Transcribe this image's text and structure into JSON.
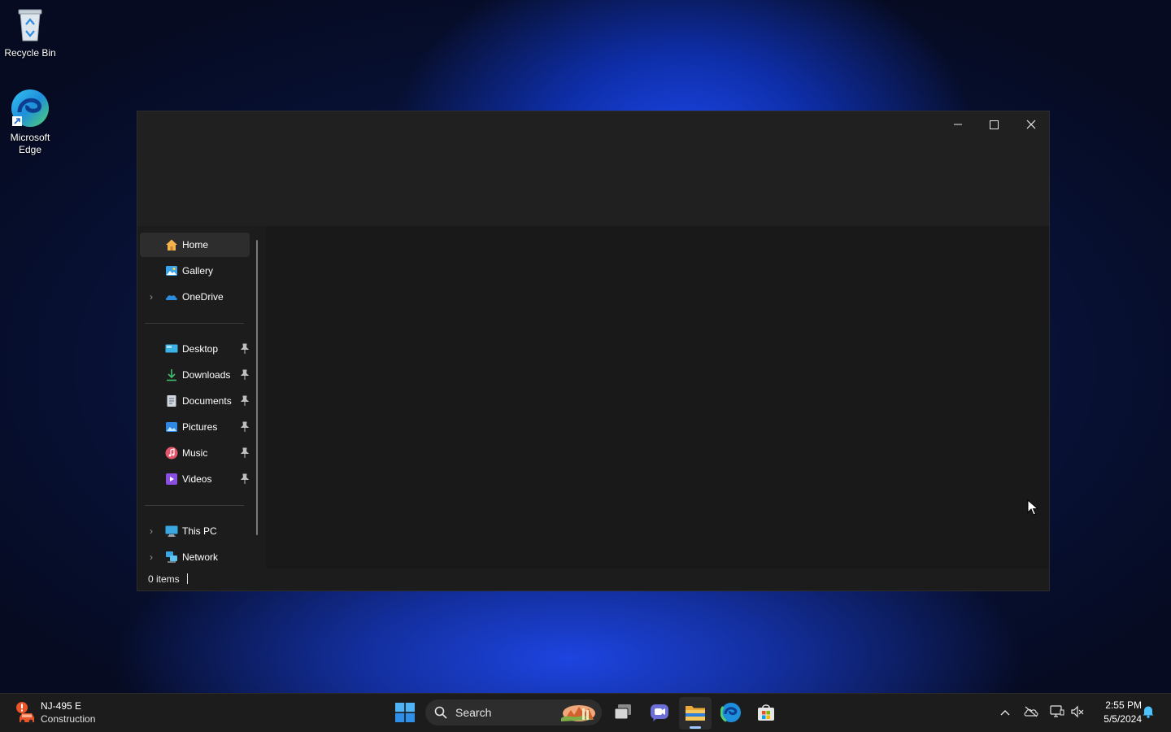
{
  "desktop": {
    "icons": [
      {
        "label": "Recycle Bin",
        "icon": "recycle-bin-icon"
      },
      {
        "label": "Microsoft Edge",
        "icon": "edge-icon"
      }
    ]
  },
  "window": {
    "controls": {
      "minimize": "minimize-icon",
      "maximize": "maximize-icon",
      "close": "close-icon"
    },
    "nav": {
      "top": [
        {
          "label": "Home",
          "icon": "home-icon",
          "active": true
        },
        {
          "label": "Gallery",
          "icon": "gallery-icon"
        },
        {
          "label": "OneDrive",
          "icon": "onedrive-icon",
          "expandable": true
        }
      ],
      "quick_access": [
        {
          "label": "Desktop",
          "icon": "desktop-folder-icon",
          "pinned": true
        },
        {
          "label": "Downloads",
          "icon": "downloads-icon",
          "pinned": true
        },
        {
          "label": "Documents",
          "icon": "documents-icon",
          "pinned": true
        },
        {
          "label": "Pictures",
          "icon": "pictures-icon",
          "pinned": true
        },
        {
          "label": "Music",
          "icon": "music-icon",
          "pinned": true
        },
        {
          "label": "Videos",
          "icon": "videos-icon",
          "pinned": true
        }
      ],
      "bottom": [
        {
          "label": "This PC",
          "icon": "this-pc-icon",
          "expandable": true
        },
        {
          "label": "Network",
          "icon": "network-icon",
          "expandable": true
        }
      ]
    },
    "status": {
      "item_count": "0 items"
    }
  },
  "taskbar": {
    "weather": {
      "line1": "NJ-495 E",
      "line2": "Construction",
      "icon": "traffic-alert-icon"
    },
    "search": {
      "placeholder": "Search"
    },
    "apps": [
      "start-icon",
      "task-view-icon",
      "chat-icon",
      "file-explorer-icon",
      "edge-icon",
      "store-icon"
    ],
    "tray": [
      "chevron-up-icon",
      "onedrive-offline-icon",
      "network-icon",
      "volume-muted-icon"
    ],
    "clock": {
      "time": "2:55 PM",
      "date": "5/5/2024"
    },
    "notification_icon": "bell-icon"
  },
  "colors": {
    "accent": "#4cc2ff",
    "window_bg": "#1c1c1c",
    "taskbar_bg": "#1c1c1c"
  }
}
